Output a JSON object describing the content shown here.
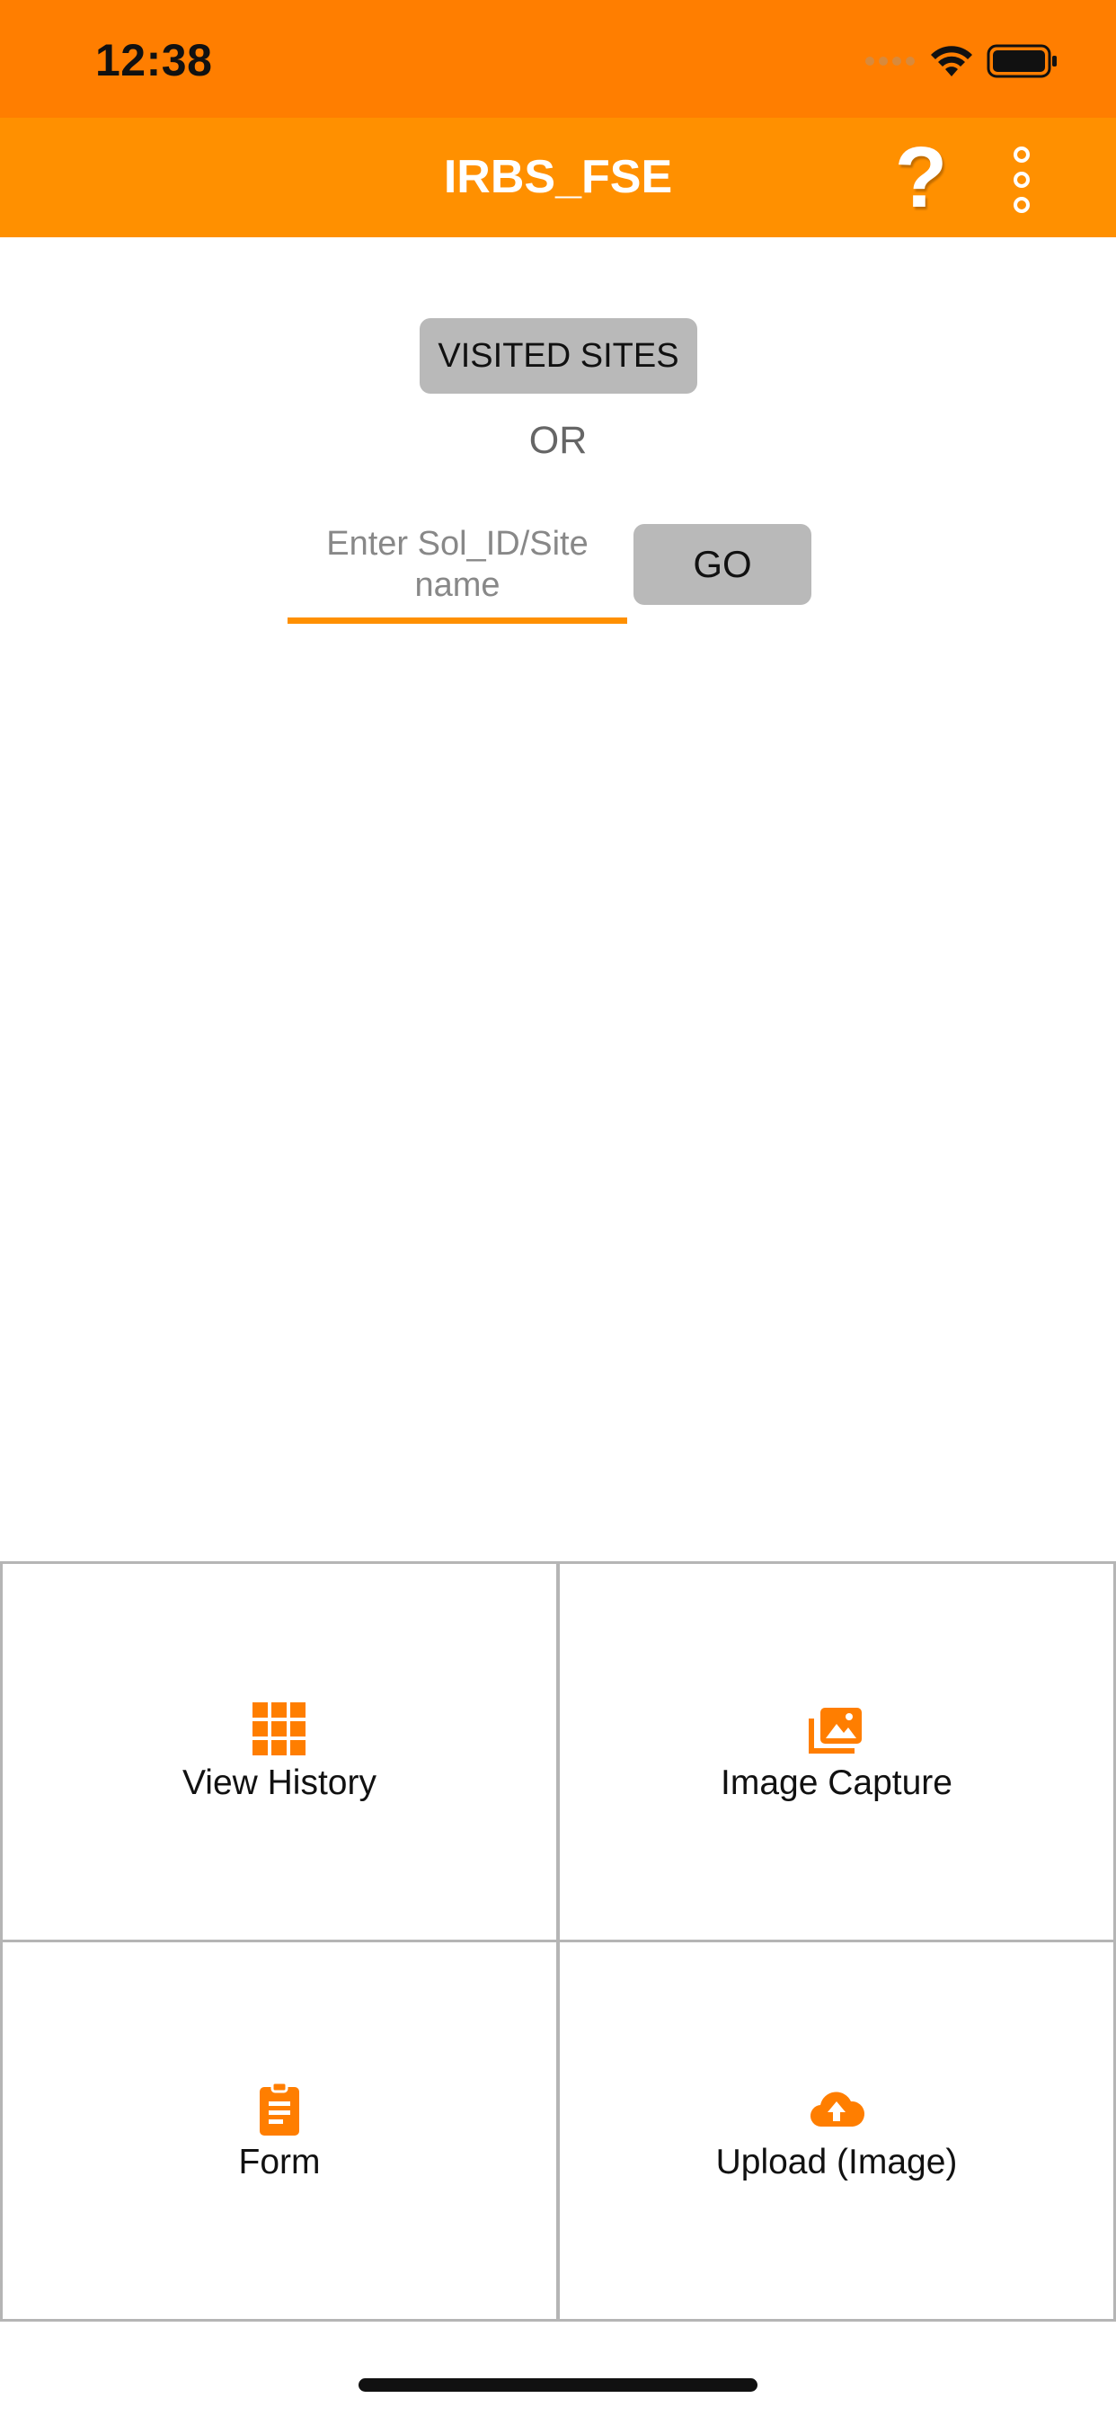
{
  "status_bar": {
    "time": "12:38"
  },
  "app_bar": {
    "title": "IRBS_FSE",
    "help_label": "?"
  },
  "search": {
    "visited_sites_label": "VISITED SITES",
    "or_label": "OR",
    "placeholder_line1": "Enter Sol_ID/Site",
    "placeholder_line2": "name",
    "go_label": "GO"
  },
  "grid": {
    "items": [
      {
        "label": "View History",
        "icon": "grid-icon"
      },
      {
        "label": "Image Capture",
        "icon": "photo-library-icon"
      },
      {
        "label": "Form",
        "icon": "clipboard-icon"
      },
      {
        "label": "Upload (Image)",
        "icon": "cloud-upload-icon"
      }
    ]
  },
  "colors": {
    "status_bar": "#ff7e00",
    "app_bar": "#ff9000",
    "accent": "#ff7e00",
    "button_gray": "#b9b9b9"
  }
}
